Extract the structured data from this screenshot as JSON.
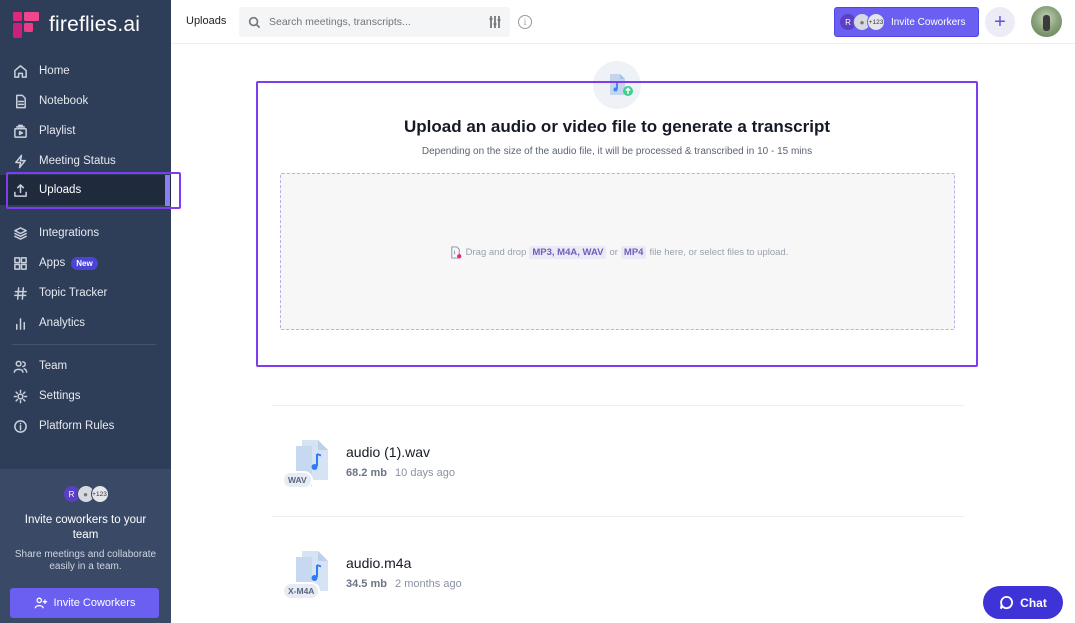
{
  "brand": {
    "name": "fireflies.ai"
  },
  "sidebar": {
    "items": [
      {
        "label": "Home",
        "icon": "home-icon"
      },
      {
        "label": "Notebook",
        "icon": "notebook-icon"
      },
      {
        "label": "Playlist",
        "icon": "playlist-icon"
      },
      {
        "label": "Meeting Status",
        "icon": "bolt-icon"
      },
      {
        "label": "Uploads",
        "icon": "upload-icon",
        "active": true
      },
      {
        "label": "Integrations",
        "icon": "layers-icon"
      },
      {
        "label": "Apps",
        "icon": "grid-icon",
        "badge": "New"
      },
      {
        "label": "Topic Tracker",
        "icon": "hash-icon"
      },
      {
        "label": "Analytics",
        "icon": "bar-chart-icon"
      },
      {
        "label": "Team",
        "icon": "team-icon"
      },
      {
        "label": "Settings",
        "icon": "gear-icon"
      },
      {
        "label": "Platform Rules",
        "icon": "info-icon"
      }
    ],
    "invite": {
      "avatar_initial": "R",
      "avatar_count": "+123",
      "title": "Invite coworkers to your team",
      "subtitle": "Share meetings and collaborate easily in a team.",
      "button_label": "Invite Coworkers"
    }
  },
  "topbar": {
    "page_label": "Uploads",
    "search_placeholder": "Search meetings, transcripts...",
    "invite_label": "Invite Coworkers",
    "avatar_initial": "R",
    "avatar_count": "+123",
    "plus_label": "+"
  },
  "upload": {
    "title": "Upload an audio or video file to generate a transcript",
    "subtitle": "Depending on the size of the audio file, it will be processed & transcribed in 10 - 15 mins",
    "drop_prefix": "Drag and drop",
    "drop_formats": "MP3, M4A, WAV",
    "drop_or": "or",
    "drop_format2": "MP4",
    "drop_suffix": "file here, or select files to upload."
  },
  "files": [
    {
      "name": "audio (1).wav",
      "size": "68.2 mb",
      "age": "10 days ago",
      "tag": "WAV"
    },
    {
      "name": "audio.m4a",
      "size": "34.5 mb",
      "age": "2 months ago",
      "tag": "X-M4A"
    }
  ],
  "chat": {
    "label": "Chat"
  },
  "colors": {
    "sidebar": "#2f3e58",
    "accent": "#6b5ff2",
    "highlight": "#7d3cf0",
    "chat": "#3d33d6"
  }
}
